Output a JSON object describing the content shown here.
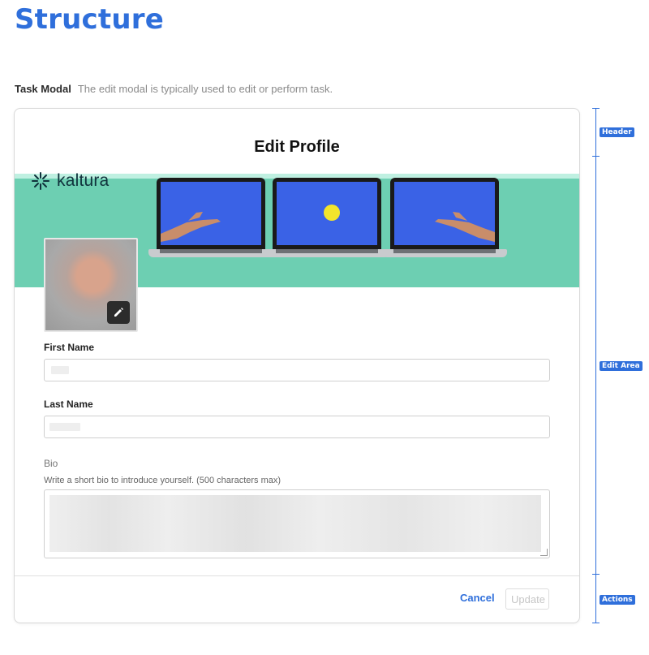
{
  "page": {
    "title": "Structure",
    "caption_strong": "Task Modal",
    "caption_text": "The edit modal is typically used to edit or perform task."
  },
  "modal": {
    "title": "Edit Profile",
    "banner": {
      "logo_text": "kaltura",
      "background_color": "#6dcfb2"
    },
    "fields": {
      "first_name_label": "First Name",
      "last_name_label": "Last Name",
      "bio_label": "Bio",
      "bio_help": "Write a short bio to introduce yourself. (500 characters max)"
    },
    "actions": {
      "cancel_label": "Cancel",
      "update_label": "Update"
    }
  },
  "annotations": {
    "header": "Header",
    "edit_area": "Edit Area",
    "actions": "Actions"
  },
  "colors": {
    "accent": "#2f6fdb",
    "screen_blue": "#3a62e6",
    "ball_yellow": "#f2e52b"
  },
  "icons": [
    "kaltura-logo-icon",
    "pencil-icon"
  ]
}
